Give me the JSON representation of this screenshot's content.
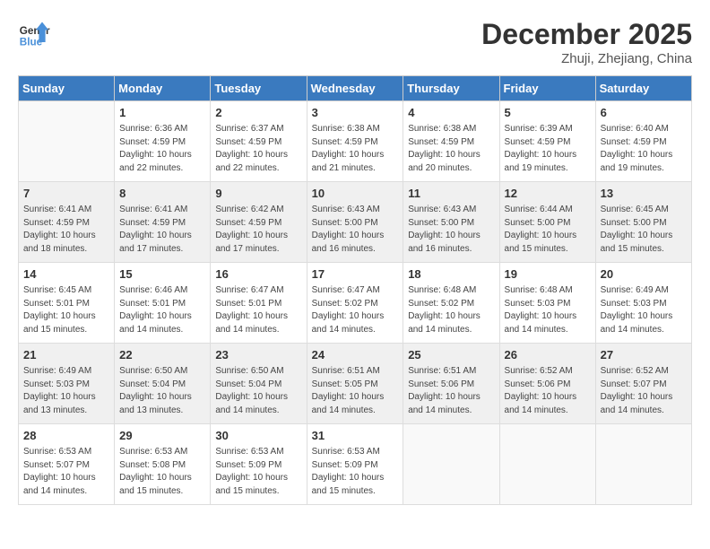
{
  "header": {
    "logo_general": "General",
    "logo_blue": "Blue",
    "month_title": "December 2025",
    "location": "Zhuji, Zhejiang, China"
  },
  "weekdays": [
    "Sunday",
    "Monday",
    "Tuesday",
    "Wednesday",
    "Thursday",
    "Friday",
    "Saturday"
  ],
  "weeks": [
    [
      {
        "day": "",
        "info": ""
      },
      {
        "day": "1",
        "info": "Sunrise: 6:36 AM\nSunset: 4:59 PM\nDaylight: 10 hours and 22 minutes."
      },
      {
        "day": "2",
        "info": "Sunrise: 6:37 AM\nSunset: 4:59 PM\nDaylight: 10 hours and 22 minutes."
      },
      {
        "day": "3",
        "info": "Sunrise: 6:38 AM\nSunset: 4:59 PM\nDaylight: 10 hours and 21 minutes."
      },
      {
        "day": "4",
        "info": "Sunrise: 6:38 AM\nSunset: 4:59 PM\nDaylight: 10 hours and 20 minutes."
      },
      {
        "day": "5",
        "info": "Sunrise: 6:39 AM\nSunset: 4:59 PM\nDaylight: 10 hours and 19 minutes."
      },
      {
        "day": "6",
        "info": "Sunrise: 6:40 AM\nSunset: 4:59 PM\nDaylight: 10 hours and 19 minutes."
      }
    ],
    [
      {
        "day": "7",
        "info": "Sunrise: 6:41 AM\nSunset: 4:59 PM\nDaylight: 10 hours and 18 minutes."
      },
      {
        "day": "8",
        "info": "Sunrise: 6:41 AM\nSunset: 4:59 PM\nDaylight: 10 hours and 17 minutes."
      },
      {
        "day": "9",
        "info": "Sunrise: 6:42 AM\nSunset: 4:59 PM\nDaylight: 10 hours and 17 minutes."
      },
      {
        "day": "10",
        "info": "Sunrise: 6:43 AM\nSunset: 5:00 PM\nDaylight: 10 hours and 16 minutes."
      },
      {
        "day": "11",
        "info": "Sunrise: 6:43 AM\nSunset: 5:00 PM\nDaylight: 10 hours and 16 minutes."
      },
      {
        "day": "12",
        "info": "Sunrise: 6:44 AM\nSunset: 5:00 PM\nDaylight: 10 hours and 15 minutes."
      },
      {
        "day": "13",
        "info": "Sunrise: 6:45 AM\nSunset: 5:00 PM\nDaylight: 10 hours and 15 minutes."
      }
    ],
    [
      {
        "day": "14",
        "info": "Sunrise: 6:45 AM\nSunset: 5:01 PM\nDaylight: 10 hours and 15 minutes."
      },
      {
        "day": "15",
        "info": "Sunrise: 6:46 AM\nSunset: 5:01 PM\nDaylight: 10 hours and 14 minutes."
      },
      {
        "day": "16",
        "info": "Sunrise: 6:47 AM\nSunset: 5:01 PM\nDaylight: 10 hours and 14 minutes."
      },
      {
        "day": "17",
        "info": "Sunrise: 6:47 AM\nSunset: 5:02 PM\nDaylight: 10 hours and 14 minutes."
      },
      {
        "day": "18",
        "info": "Sunrise: 6:48 AM\nSunset: 5:02 PM\nDaylight: 10 hours and 14 minutes."
      },
      {
        "day": "19",
        "info": "Sunrise: 6:48 AM\nSunset: 5:03 PM\nDaylight: 10 hours and 14 minutes."
      },
      {
        "day": "20",
        "info": "Sunrise: 6:49 AM\nSunset: 5:03 PM\nDaylight: 10 hours and 14 minutes."
      }
    ],
    [
      {
        "day": "21",
        "info": "Sunrise: 6:49 AM\nSunset: 5:03 PM\nDaylight: 10 hours and 13 minutes."
      },
      {
        "day": "22",
        "info": "Sunrise: 6:50 AM\nSunset: 5:04 PM\nDaylight: 10 hours and 13 minutes."
      },
      {
        "day": "23",
        "info": "Sunrise: 6:50 AM\nSunset: 5:04 PM\nDaylight: 10 hours and 14 minutes."
      },
      {
        "day": "24",
        "info": "Sunrise: 6:51 AM\nSunset: 5:05 PM\nDaylight: 10 hours and 14 minutes."
      },
      {
        "day": "25",
        "info": "Sunrise: 6:51 AM\nSunset: 5:06 PM\nDaylight: 10 hours and 14 minutes."
      },
      {
        "day": "26",
        "info": "Sunrise: 6:52 AM\nSunset: 5:06 PM\nDaylight: 10 hours and 14 minutes."
      },
      {
        "day": "27",
        "info": "Sunrise: 6:52 AM\nSunset: 5:07 PM\nDaylight: 10 hours and 14 minutes."
      }
    ],
    [
      {
        "day": "28",
        "info": "Sunrise: 6:53 AM\nSunset: 5:07 PM\nDaylight: 10 hours and 14 minutes."
      },
      {
        "day": "29",
        "info": "Sunrise: 6:53 AM\nSunset: 5:08 PM\nDaylight: 10 hours and 15 minutes."
      },
      {
        "day": "30",
        "info": "Sunrise: 6:53 AM\nSunset: 5:09 PM\nDaylight: 10 hours and 15 minutes."
      },
      {
        "day": "31",
        "info": "Sunrise: 6:53 AM\nSunset: 5:09 PM\nDaylight: 10 hours and 15 minutes."
      },
      {
        "day": "",
        "info": ""
      },
      {
        "day": "",
        "info": ""
      },
      {
        "day": "",
        "info": ""
      }
    ]
  ]
}
